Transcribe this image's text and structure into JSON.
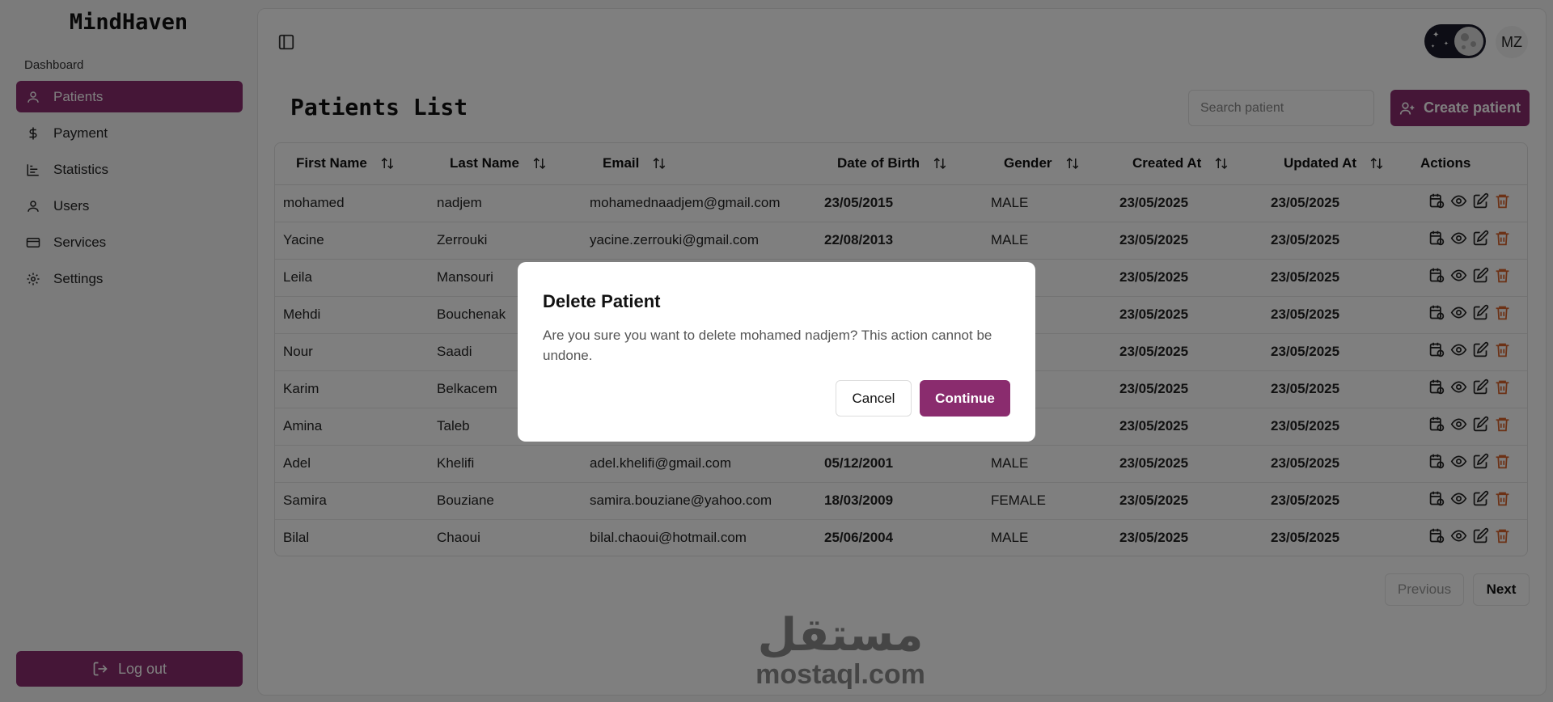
{
  "app": {
    "name": "MindHaven"
  },
  "sidebar": {
    "section_label": "Dashboard",
    "items": [
      {
        "label": "Patients",
        "icon": "user-icon",
        "active": true
      },
      {
        "label": "Payment",
        "icon": "dollar-icon",
        "active": false
      },
      {
        "label": "Statistics",
        "icon": "chart-icon",
        "active": false
      },
      {
        "label": "Users",
        "icon": "user-icon",
        "active": false
      },
      {
        "label": "Services",
        "icon": "card-icon",
        "active": false
      },
      {
        "label": "Settings",
        "icon": "gear-icon",
        "active": false
      }
    ],
    "logout_label": "Log out"
  },
  "header": {
    "avatar_initials": "MZ"
  },
  "main": {
    "title": "Patients List",
    "search_placeholder": "Search patient",
    "create_label": "Create patient"
  },
  "table": {
    "columns": [
      "First Name",
      "Last Name",
      "Email",
      "Date of Birth",
      "Gender",
      "Created At",
      "Updated At",
      "Actions"
    ],
    "rows": [
      [
        "mohamed",
        "nadjem",
        "mohamednaadjem@gmail.com",
        "23/05/2015",
        "MALE",
        "23/05/2025",
        "23/05/2025"
      ],
      [
        "Yacine",
        "Zerrouki",
        "yacine.zerrouki@gmail.com",
        "22/08/2013",
        "MALE",
        "23/05/2025",
        "23/05/2025"
      ],
      [
        "Leila",
        "Mansouri",
        "",
        "",
        "",
        "23/05/2025",
        "23/05/2025"
      ],
      [
        "Mehdi",
        "Bouchenak",
        "",
        "",
        "",
        "23/05/2025",
        "23/05/2025"
      ],
      [
        "Nour",
        "Saadi",
        "",
        "",
        "",
        "23/05/2025",
        "23/05/2025"
      ],
      [
        "Karim",
        "Belkacem",
        "",
        "",
        "",
        "23/05/2025",
        "23/05/2025"
      ],
      [
        "Amina",
        "Taleb",
        "",
        "",
        "",
        "23/05/2025",
        "23/05/2025"
      ],
      [
        "Adel",
        "Khelifi",
        "adel.khelifi@gmail.com",
        "05/12/2001",
        "MALE",
        "23/05/2025",
        "23/05/2025"
      ],
      [
        "Samira",
        "Bouziane",
        "samira.bouziane@yahoo.com",
        "18/03/2009",
        "FEMALE",
        "23/05/2025",
        "23/05/2025"
      ],
      [
        "Bilal",
        "Chaoui",
        "bilal.chaoui@hotmail.com",
        "25/06/2004",
        "MALE",
        "23/05/2025",
        "23/05/2025"
      ]
    ]
  },
  "pagination": {
    "previous_label": "Previous",
    "next_label": "Next"
  },
  "watermark": {
    "arabic": "مستقل",
    "latin": "mostaql.com"
  },
  "dialog": {
    "title": "Delete Patient",
    "message": "Are you sure you want to delete mohamed nadjem? This action cannot be undone.",
    "cancel_label": "Cancel",
    "continue_label": "Continue"
  },
  "colors": {
    "brand": "#8a2c6e",
    "danger_icon": "#d9622b"
  }
}
